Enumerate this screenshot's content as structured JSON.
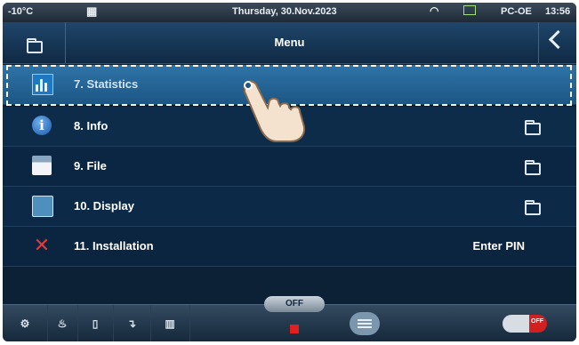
{
  "status_bar": {
    "temperature": "-10°C",
    "date": "Thursday, 30.Nov.2023",
    "station": "PC-OE",
    "time": "13:56"
  },
  "header": {
    "title": "Menu"
  },
  "menu_items": [
    {
      "label": "7.  Statistics",
      "icon": "statistics-icon",
      "trailing": ""
    },
    {
      "label": "8.  Info",
      "icon": "info-icon",
      "trailing": "folder-icon"
    },
    {
      "label": "9.  File",
      "icon": "file-icon",
      "trailing": "folder-icon"
    },
    {
      "label": "10. Display",
      "icon": "display-icon",
      "trailing": "folder-icon"
    },
    {
      "label": "11. Installation",
      "icon": "tools-icon",
      "trailing_text": "Enter PIN"
    }
  ],
  "bottom_bar": {
    "mode_pill": "OFF",
    "power_toggle": "OFF"
  },
  "colors": {
    "background": "#0c2136",
    "selected_row": "#2f74a8",
    "stop": "#e11f1f"
  }
}
